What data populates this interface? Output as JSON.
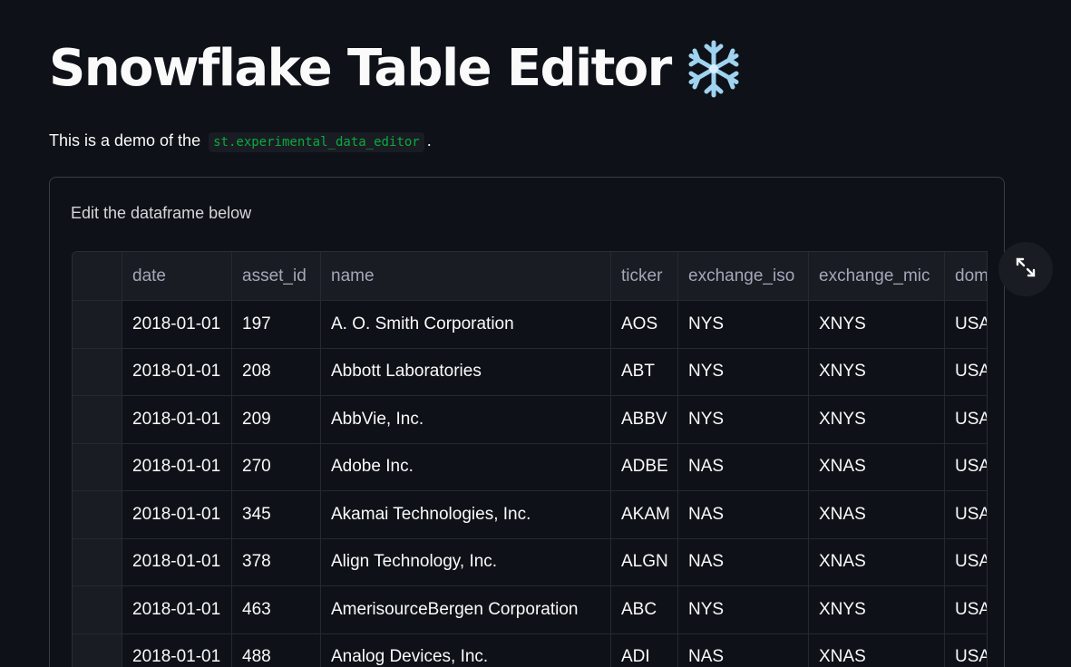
{
  "page": {
    "title": "Snowflake Table Editor",
    "title_emoji_icon": "snowflake-emoji-icon",
    "subtitle_prefix": "This is a demo of the",
    "subtitle_code": "st.experimental_data_editor",
    "subtitle_suffix": "."
  },
  "form": {
    "label": "Edit the dataframe below"
  },
  "table": {
    "columns": [
      "",
      "date",
      "asset_id",
      "name",
      "ticker",
      "exchange_iso",
      "exchange_mic",
      "domicile"
    ],
    "rows": [
      [
        "",
        "2018-01-01",
        "197",
        "A. O. Smith Corporation",
        "AOS",
        "NYS",
        "XNYS",
        "USA"
      ],
      [
        "",
        "2018-01-01",
        "208",
        "Abbott Laboratories",
        "ABT",
        "NYS",
        "XNYS",
        "USA"
      ],
      [
        "",
        "2018-01-01",
        "209",
        "AbbVie, Inc.",
        "ABBV",
        "NYS",
        "XNYS",
        "USA"
      ],
      [
        "",
        "2018-01-01",
        "270",
        "Adobe Inc.",
        "ADBE",
        "NAS",
        "XNAS",
        "USA"
      ],
      [
        "",
        "2018-01-01",
        "345",
        "Akamai Technologies, Inc.",
        "AKAM",
        "NAS",
        "XNAS",
        "USA"
      ],
      [
        "",
        "2018-01-01",
        "378",
        "Align Technology, Inc.",
        "ALGN",
        "NAS",
        "XNAS",
        "USA"
      ],
      [
        "",
        "2018-01-01",
        "463",
        "AmerisourceBergen Corporation",
        "ABC",
        "NYS",
        "XNYS",
        "USA"
      ],
      [
        "",
        "2018-01-01",
        "488",
        "Analog Devices, Inc.",
        "ADI",
        "NAS",
        "XNAS",
        "USA"
      ]
    ]
  },
  "controls": {
    "fullscreen_icon": "expand-icon"
  },
  "colors": {
    "background": "#0e1117",
    "code_text": "#09ab3b",
    "header_bg": "#1a1c23"
  }
}
